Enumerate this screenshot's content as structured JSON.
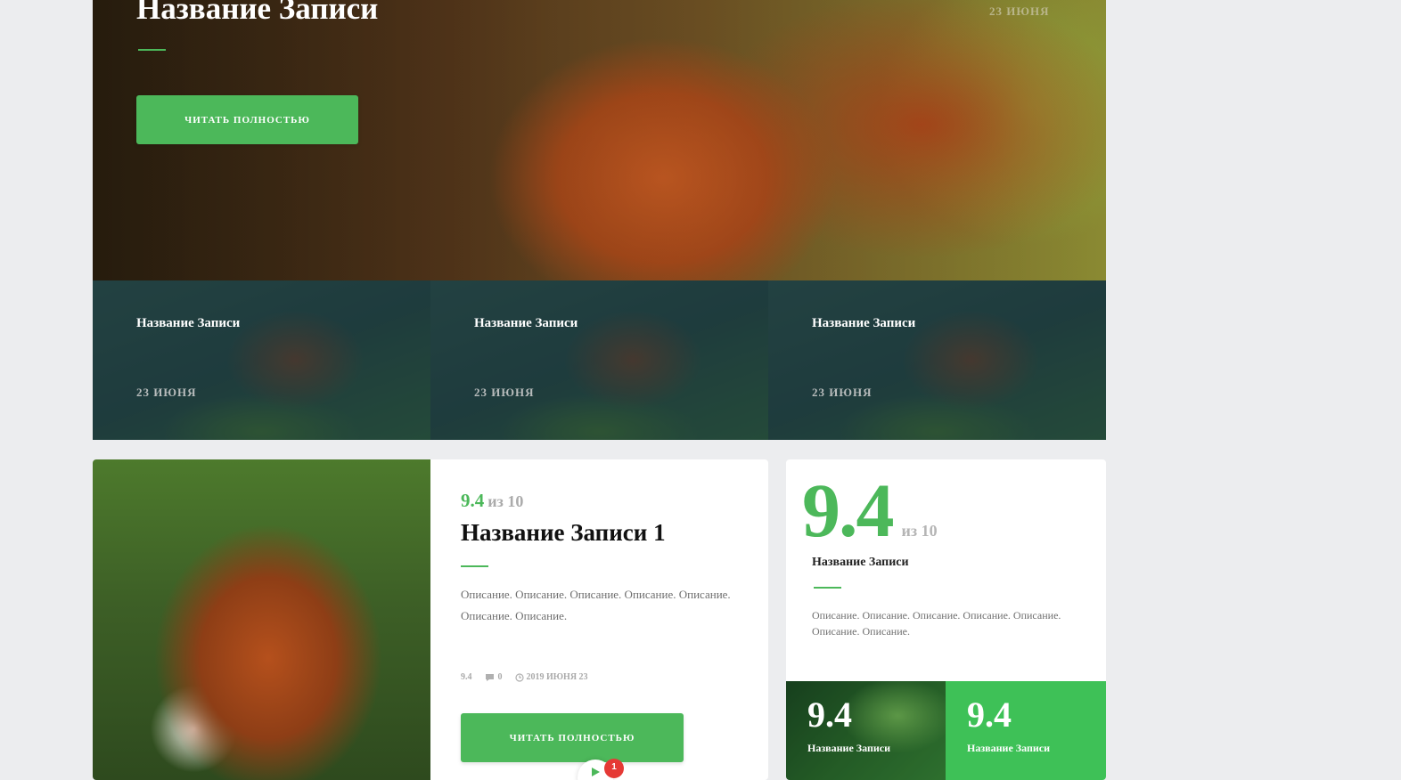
{
  "hero": {
    "title": "Название Записи",
    "date": "23 июня",
    "button_label": "читать полностью"
  },
  "thumbs": [
    {
      "title": "Название Записи",
      "date": "23 июня"
    },
    {
      "title": "Название Записи",
      "date": "23 июня"
    },
    {
      "title": "Название Записи",
      "date": "23 июня"
    }
  ],
  "review_card": {
    "score": "9.4",
    "score_suffix": "из 10",
    "title": "Название Записи 1",
    "description": "Описание. Описание. Описание. Описание. Описание. Описание. Описание.",
    "meta": {
      "rating": "9.4",
      "comments": "0",
      "date": "2019 июня 23"
    },
    "button_label": "читать полностью",
    "badge_count": "1"
  },
  "score_card": {
    "score": "9.4",
    "score_suffix": "из 10",
    "title": "Название Записи",
    "description": "Описание. Описание. Описание. Описание. Описание. Описание. Описание."
  },
  "mini_tiles": [
    {
      "score": "9.4",
      "title": "Название Записи"
    },
    {
      "score": "9.4",
      "title": "Название Записи"
    }
  ],
  "colors": {
    "accent": "#4cb85a",
    "bright_green": "#3ec157",
    "background": "#ecedef"
  }
}
